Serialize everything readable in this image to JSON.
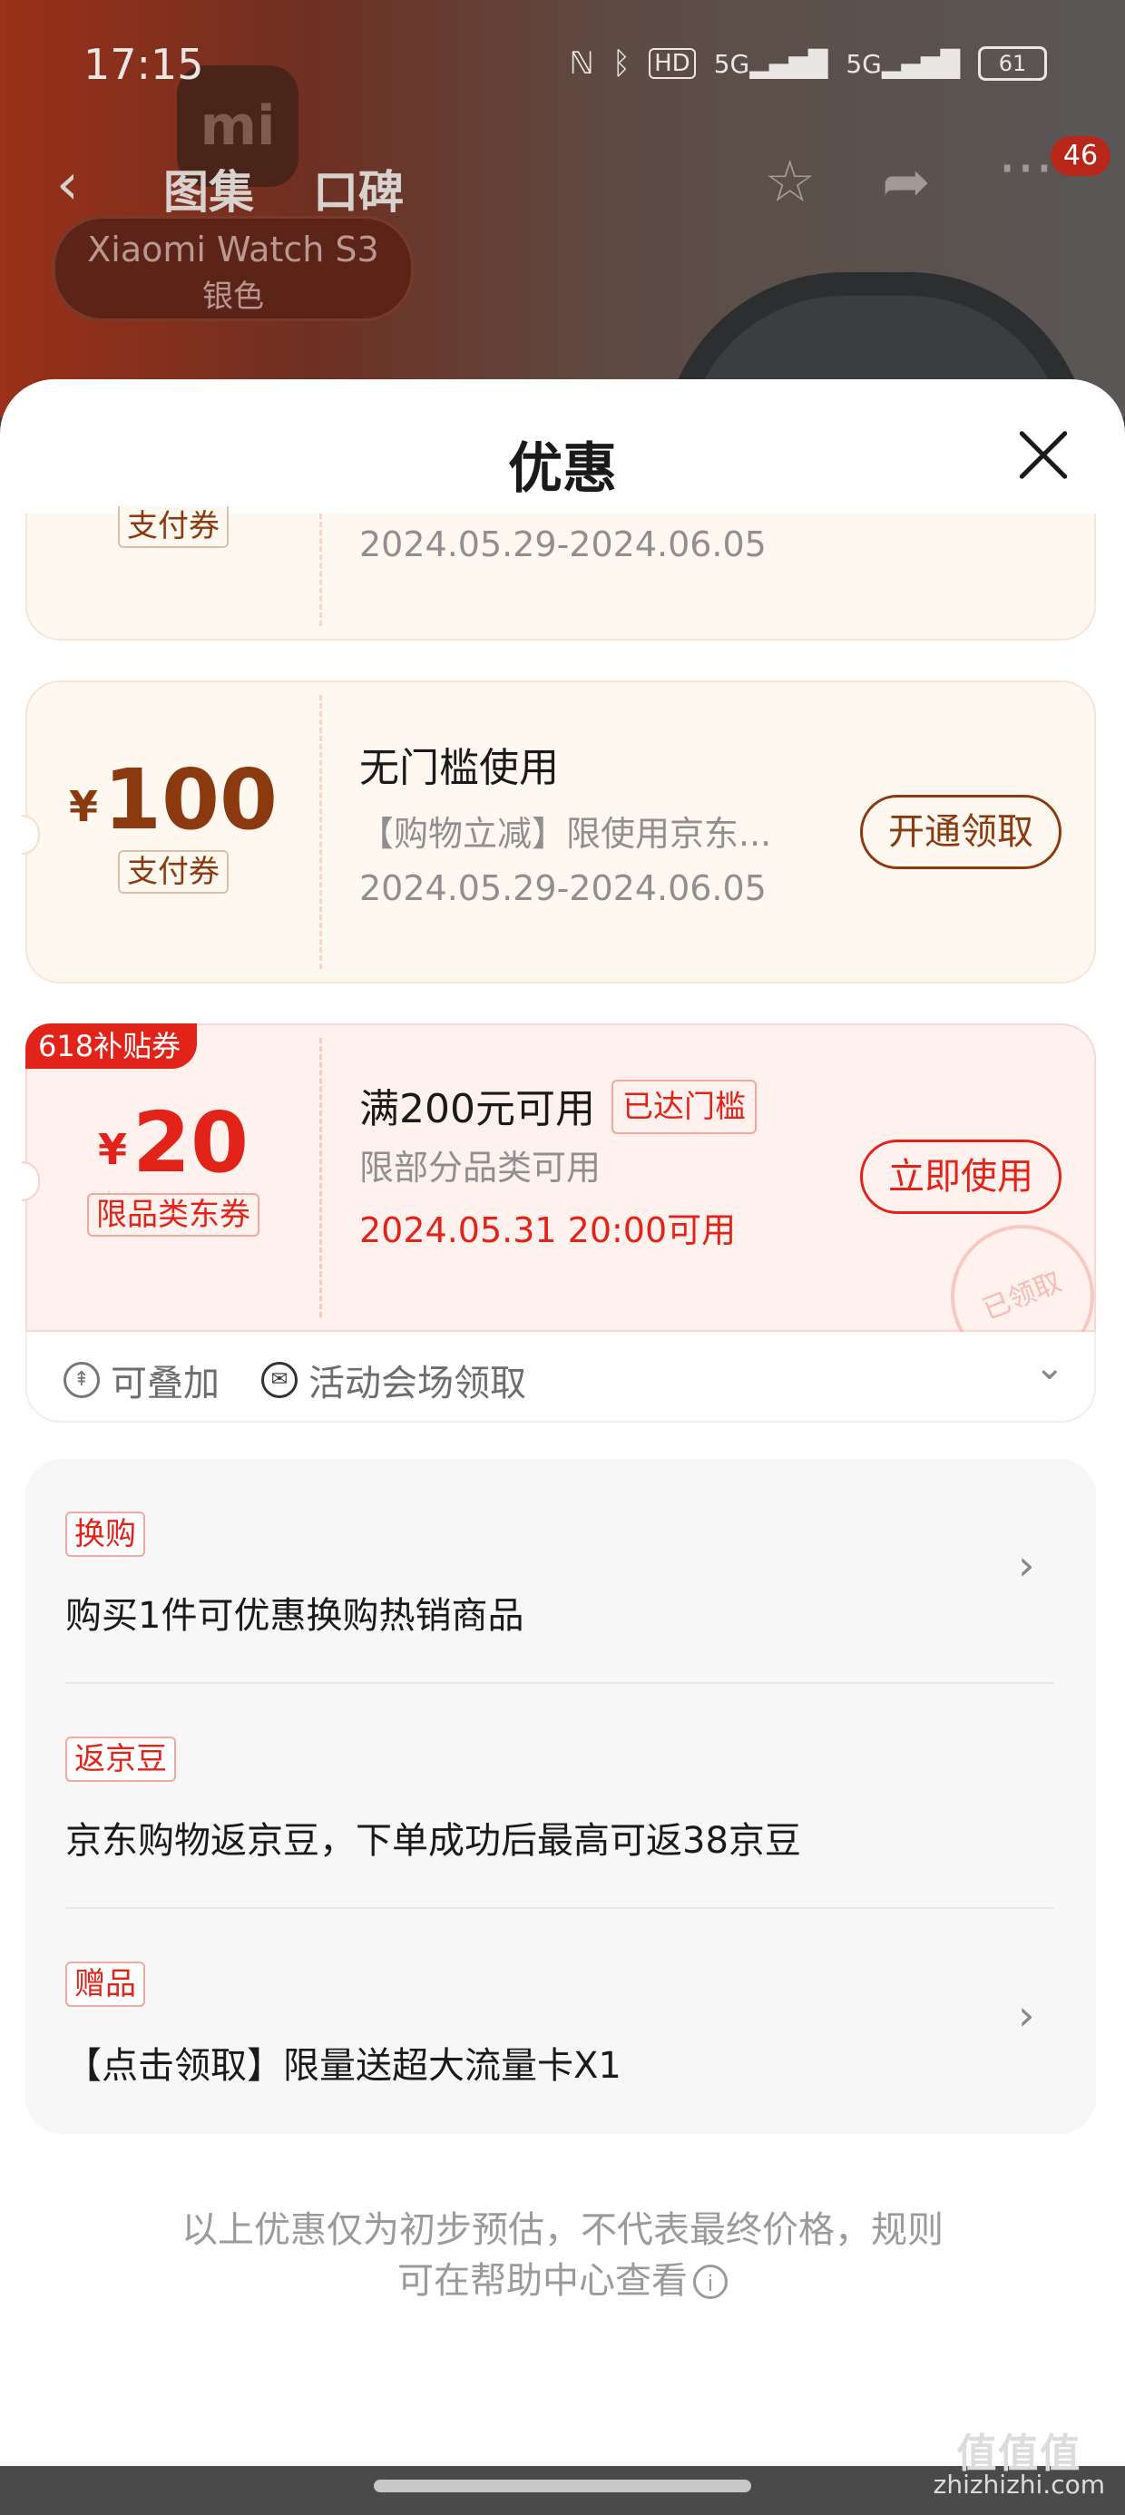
{
  "status_bar": {
    "time": "17:15",
    "battery": "61",
    "icons": [
      "nfc-icon",
      "bluetooth-icon",
      "hd-icon",
      "signal-5g-icon",
      "signal-5g-icon"
    ]
  },
  "product_page": {
    "tabs": [
      "图集",
      "口碑"
    ],
    "badge_line1": "Xiaomi Watch S3",
    "badge_line2": "银色",
    "logo_text": "mi",
    "notification_count": "46"
  },
  "sheet": {
    "title": "优惠",
    "coupons": [
      {
        "tag": "支付券",
        "date": "2024.05.29-2024.06.05"
      },
      {
        "currency": "¥",
        "amount": "100",
        "tag": "支付券",
        "title": "无门槛使用",
        "desc": "【购物立减】限使用京东...",
        "date": "2024.05.29-2024.06.05",
        "button": "开通领取"
      },
      {
        "corner_badge": "618补贴券",
        "currency": "¥",
        "amount": "20",
        "tag": "限品类东券",
        "title": "满200元可用",
        "reached": "已达门槛",
        "desc": "限部分品类可用",
        "date": "2024.05.31 20:00可用",
        "button": "立即使用",
        "stamp": "已领取",
        "stackable": "可叠加",
        "source": "活动会场领取"
      }
    ],
    "promos": [
      {
        "tag": "换购",
        "text": "购买1件可优惠换购热销商品"
      },
      {
        "tag": "返京豆",
        "text": "京东购物返京豆，下单成功后最高可返38京豆"
      },
      {
        "tag": "赠品",
        "text": "【点击领取】限量送超大流量卡X1"
      }
    ],
    "footnote_line1": "以上优惠仅为初步预估，不代表最终价格，规则",
    "footnote_line2": "可在帮助中心查看"
  },
  "watermark": {
    "logo": "值值值",
    "domain": "zhizhizhi.com"
  },
  "colors": {
    "accent_red": "#e2231a",
    "coupon_brown": "#8b3a10",
    "coupon_bg": "#fff8f0",
    "coupon_red_bg": "#fff1ee"
  }
}
